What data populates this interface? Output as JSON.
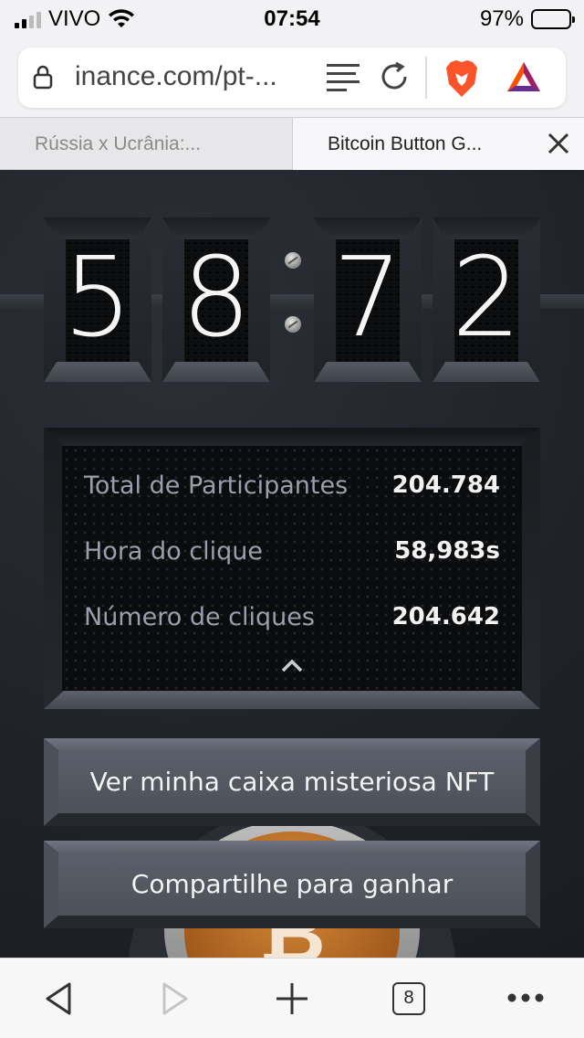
{
  "status_bar": {
    "carrier": "VIVO",
    "time": "07:54",
    "battery": "97%"
  },
  "browser": {
    "url": "inance.com/pt-...",
    "tabs": [
      {
        "label": "Rússia x Ucrânia:..."
      },
      {
        "label": "Bitcoin Button G..."
      }
    ],
    "tab_count": "8"
  },
  "counter": {
    "digits": [
      "5",
      "8",
      "7",
      "2"
    ]
  },
  "stats": {
    "rows": [
      {
        "label": "Total de Participantes",
        "value": "204.784"
      },
      {
        "label": "Hora do clique",
        "value": "58,983s"
      },
      {
        "label": "Número de cliques",
        "value": "204.642"
      }
    ]
  },
  "buttons": {
    "nft_label": "Ver minha caixa misteriosa NFT",
    "share_label": "Compartilhe para ganhar"
  },
  "colors": {
    "background": "#1f2227",
    "button_face": "#565b64",
    "coin_gold": "#c97a2f"
  },
  "icons": [
    "signal-icon",
    "wifi-icon",
    "battery-icon",
    "lock-icon",
    "reader-icon",
    "reload-icon",
    "brave-lion-icon",
    "bat-triangle-icon",
    "close-icon",
    "chevron-up-icon",
    "back-icon",
    "forward-icon",
    "plus-icon",
    "tabs-icon",
    "more-icon"
  ]
}
